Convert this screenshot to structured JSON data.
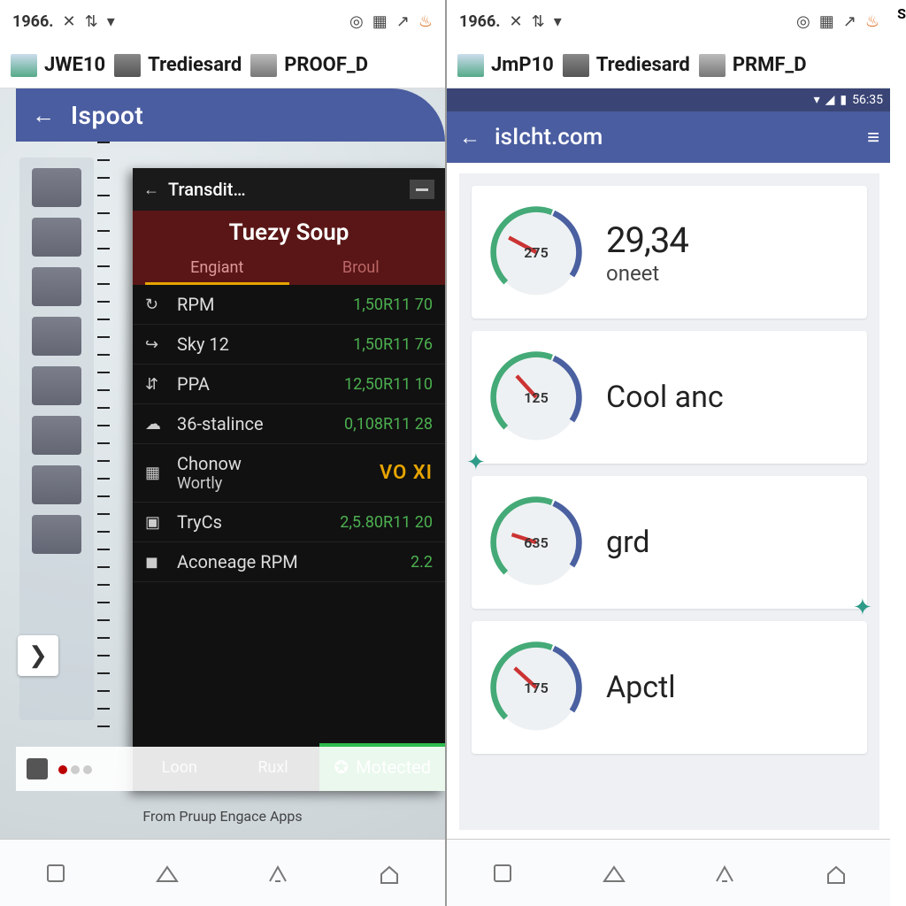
{
  "topbar": {
    "time": "1966.",
    "icons": [
      "✕",
      "⇅",
      "▾"
    ]
  },
  "tabs": [
    {
      "label": "JWE10"
    },
    {
      "label": "Trediesard"
    },
    {
      "label": "PROOF_D"
    }
  ],
  "tabs_right": [
    {
      "label": "JmP10"
    },
    {
      "label": "Trediesard"
    },
    {
      "label": "PRMF_D"
    }
  ],
  "left": {
    "appbar_title": "Ispoot",
    "panel_header": "Transdit…",
    "ribbon_title": "Tuezy Soup",
    "ribbon_tabs": [
      "Engiant",
      "Broul"
    ],
    "rows": [
      {
        "icon": "↻",
        "label": "RPM",
        "value": "1,50R11 70"
      },
      {
        "icon": "↪",
        "label": "Sky 12",
        "value": "1,50R11 76"
      },
      {
        "icon": "⇵",
        "label": "PPA",
        "value": "12,50R11 10"
      },
      {
        "icon": "☁",
        "label": "36-stalince",
        "value": "0,108R11 28"
      },
      {
        "icon": "▦",
        "label": "Chonow",
        "sublabel": "Wortly",
        "value": "VO XI",
        "valclass": "orange"
      },
      {
        "icon": "▣",
        "label": "TryCs",
        "value": "2,5.80R11 20"
      },
      {
        "icon": "◼",
        "label": "Aconeage RPM",
        "value": "2.2"
      }
    ],
    "bottom": {
      "left": "Loon",
      "mid": "Ruxl",
      "protected": "Motected"
    },
    "caption": "From Pruup Engace Apps"
  },
  "right": {
    "status_time": "56:35",
    "appbar_title": "isIcht.com",
    "cards": [
      {
        "gauge": "275",
        "big": "29,34",
        "sub": "oneet"
      },
      {
        "gauge": "125",
        "label": "Cool anc",
        "spark": "bl"
      },
      {
        "gauge": "635",
        "label": "grd",
        "spark": "br"
      },
      {
        "gauge": "175",
        "label": "Apctl"
      }
    ]
  }
}
